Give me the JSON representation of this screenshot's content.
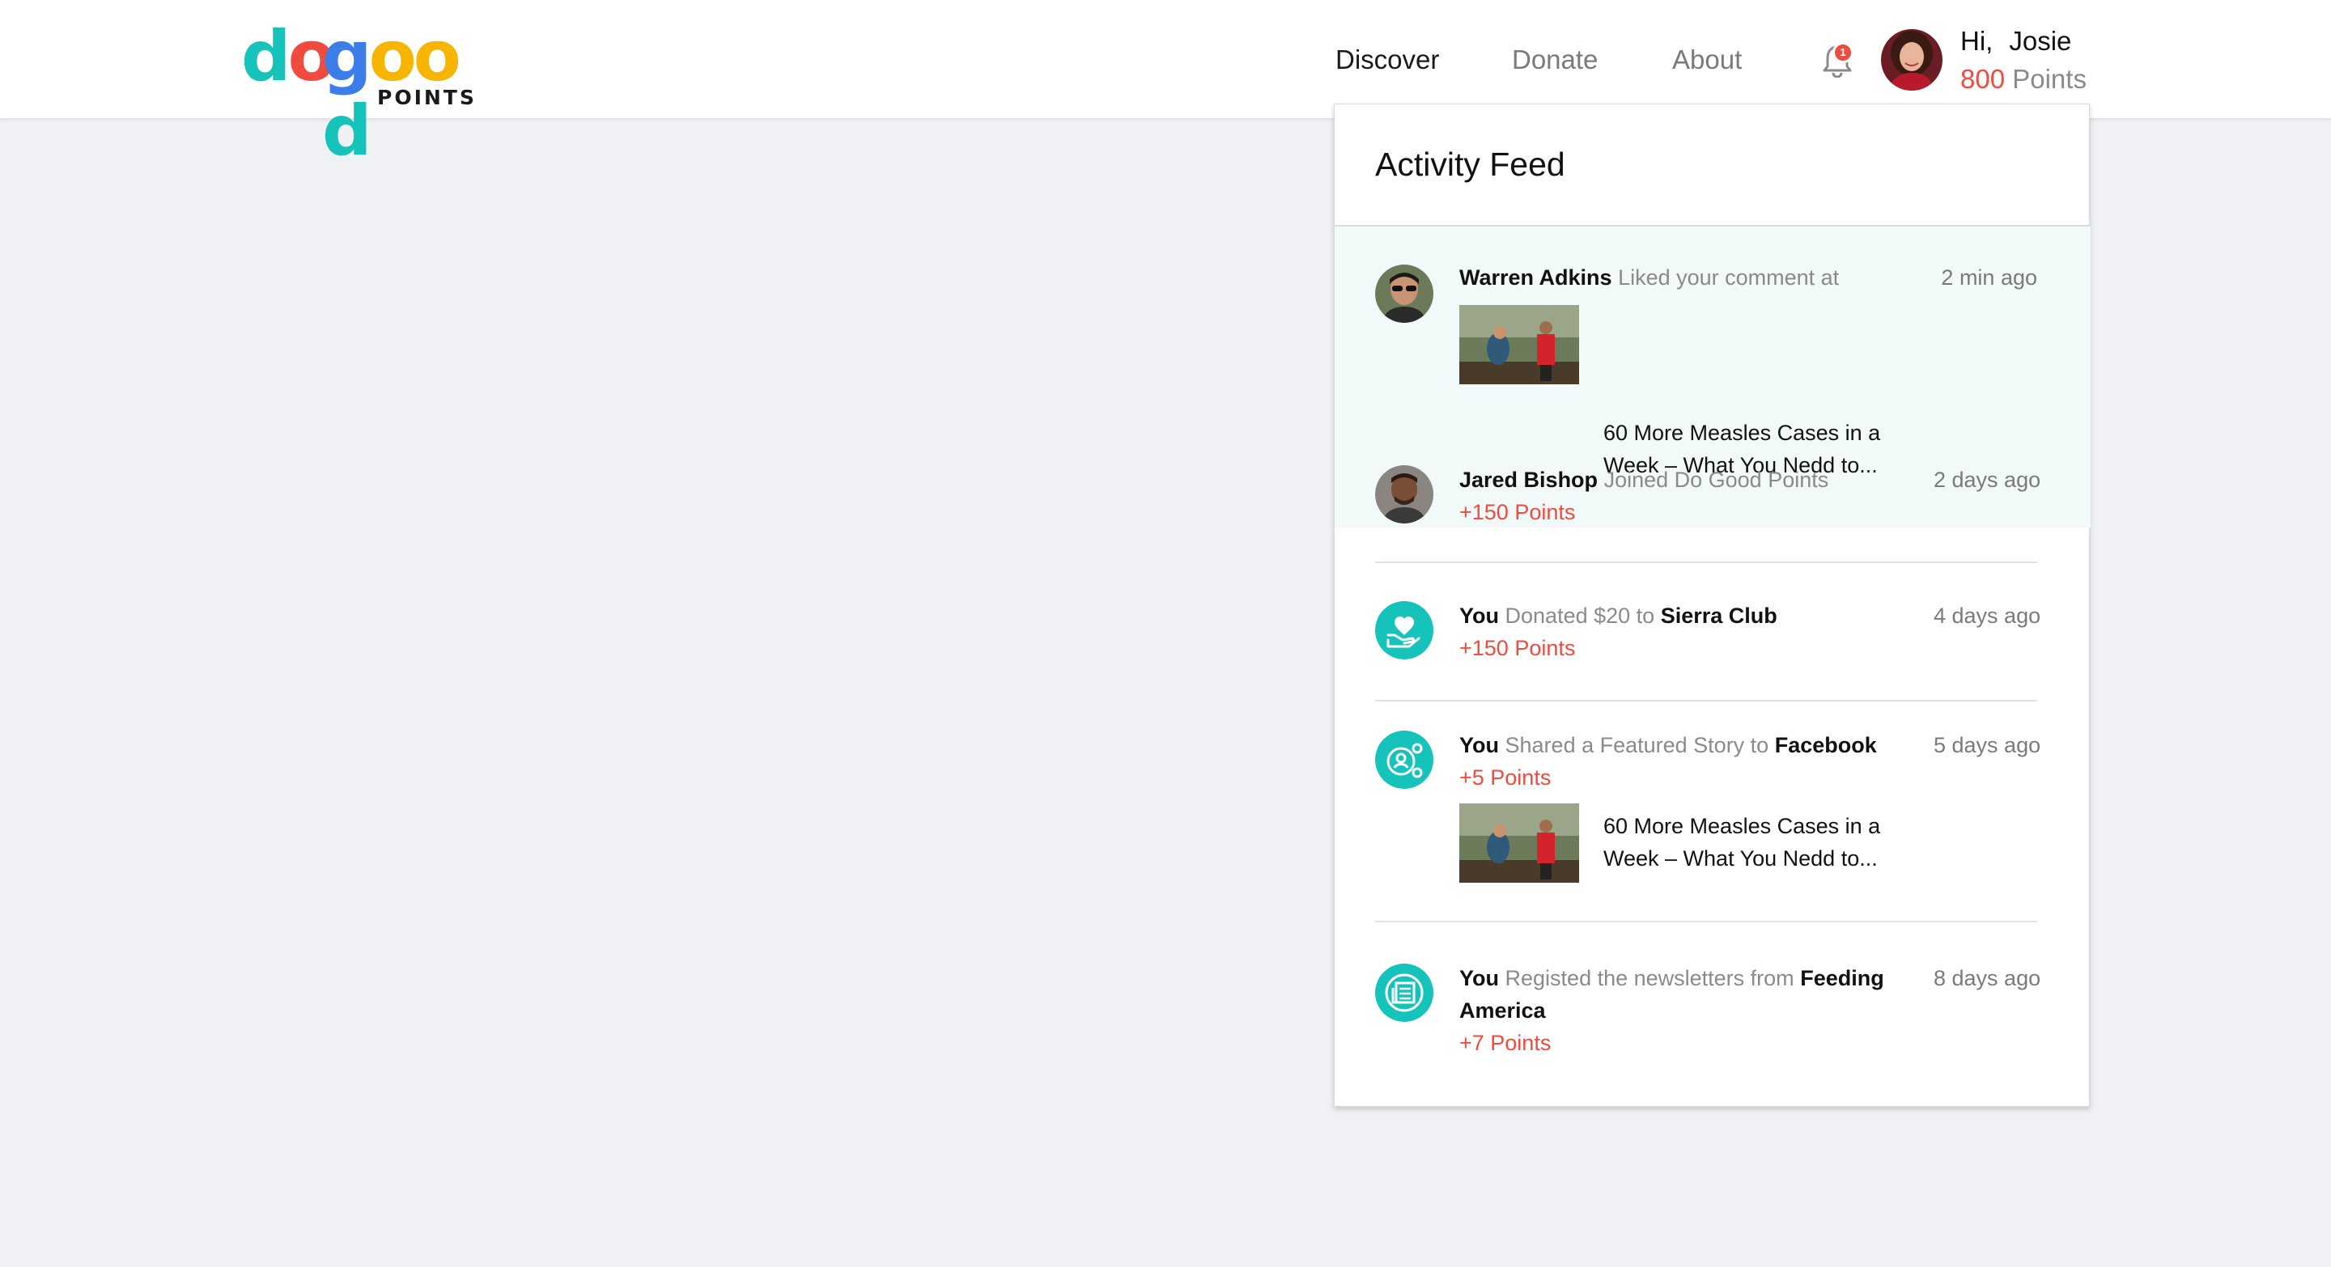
{
  "logo": {
    "letters_do": [
      "d",
      "o"
    ],
    "letters_good": [
      "g",
      "o",
      "o",
      "d"
    ],
    "letter_colors_do": [
      "#15c3bb",
      "#ef4b3f"
    ],
    "letter_colors_good": [
      "#3b7de9",
      "#f7b500",
      "#f7b500",
      "#15c3bb"
    ],
    "tagline": "POINTS"
  },
  "nav": {
    "discover": "Discover",
    "donate": "Donate",
    "about": "About"
  },
  "notifications": {
    "badge": "1"
  },
  "user": {
    "greeting": "Hi,",
    "name": "Josie",
    "points_value": "800",
    "points_word": "Points"
  },
  "feed": {
    "title": "Activity Feed",
    "items": [
      {
        "actor": "Warren Adkins",
        "action": "Liked your comment at",
        "time": "2 min ago",
        "story": "60 More Measles Cases in a Week – What You Nedd to..."
      },
      {
        "actor": "Jared Bishop",
        "action": "Joined Do Good Points",
        "time": "2 days ago",
        "points": "+150 Points"
      },
      {
        "actor": "You",
        "action": "Donated $20 to",
        "target": "Sierra Club",
        "time": "4 days ago",
        "points": "+150 Points"
      },
      {
        "actor": "You",
        "action": "Shared a Featured Story to",
        "target": "Facebook",
        "time": "5 days ago",
        "points": "+5 Points",
        "story": "60 More Measles Cases in a Week – What You Nedd to..."
      },
      {
        "actor": "You",
        "action": "Registed the newsletters from",
        "target": "Feeding",
        "target_line2": "America",
        "time": "8 days ago",
        "points": "+7 Points"
      }
    ]
  },
  "colors": {
    "accent_teal": "#15c3bb",
    "points_red": "#ef4b3f",
    "highlight_bg": "#f1faf8",
    "page_bg": "#f0f1f5"
  },
  "icons": {
    "bell": "bell-icon",
    "donate": "heart-in-hand-icon",
    "share": "share-user-icon",
    "newsletter": "newsletter-icon"
  }
}
